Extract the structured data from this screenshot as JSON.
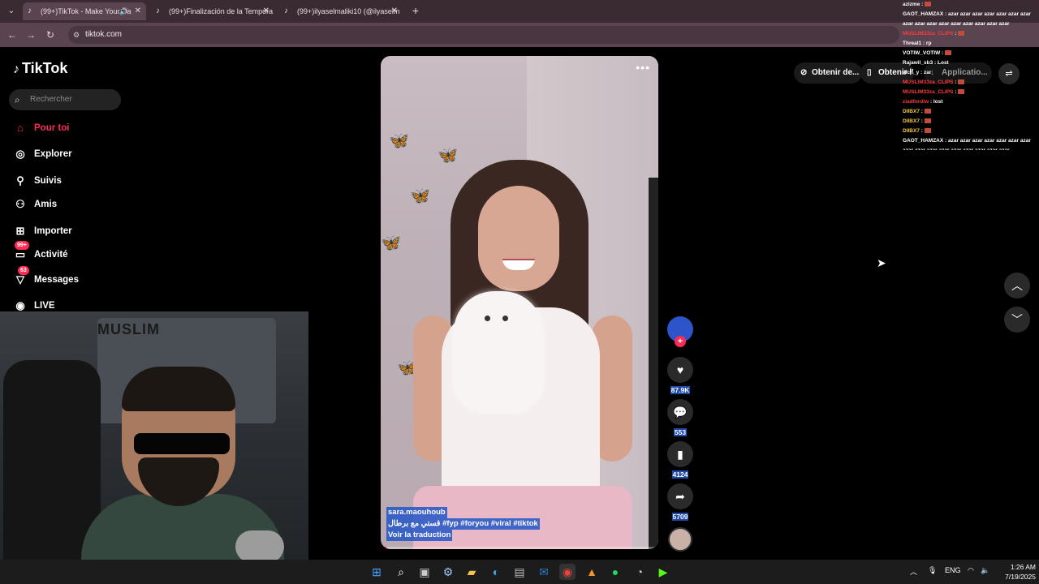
{
  "browser": {
    "tabs": [
      {
        "title": "(99+)TikTok - Make Your Da"
      },
      {
        "title": "(99+)Finalización de la Tempora"
      },
      {
        "title": "(99+)ilyaselmaliki10 (@ilyaselm"
      }
    ],
    "url": "tiktok.com"
  },
  "sidebar": {
    "logo": "TikTok",
    "search_placeholder": "Rechercher",
    "items": [
      {
        "label": "Pour toi",
        "icon": "home-icon"
      },
      {
        "label": "Explorer",
        "icon": "compass-icon"
      },
      {
        "label": "Suivis",
        "icon": "following-icon"
      },
      {
        "label": "Amis",
        "icon": "friends-icon"
      },
      {
        "label": "Importer",
        "icon": "upload-icon"
      },
      {
        "label": "Activité",
        "icon": "activity-icon",
        "badge": "99+"
      },
      {
        "label": "Messages",
        "icon": "messages-icon",
        "badge": "63"
      },
      {
        "label": "LIVE",
        "icon": "live-icon"
      }
    ]
  },
  "webcam": {
    "overlay_text": "MUSLIM"
  },
  "video": {
    "author": "sara.maouhoub",
    "caption": "قستي مع برطال #fyp  #foryou  #viral  #tiktok",
    "translate": "Voir la traduction",
    "progress": 0.02
  },
  "actions": {
    "likes": "87.9K",
    "comments": "553",
    "saves": "4124",
    "shares": "5709"
  },
  "top_chips": {
    "get_coins": "Obtenir de...",
    "get_app": "Obtenir l'a...",
    "application": "Applicatio..."
  },
  "chat": [
    {
      "user": "azizme",
      "msg": ":",
      "color": "#ffffff"
    },
    {
      "user": "GAOT_HAMZAX",
      "msg": ": azar azar azar azar azar azar azar azar azar azar azar azar azar azar azar azar",
      "color": "#ffffff"
    },
    {
      "user": "MUSLIM33za_CLIPS",
      "msg": ":",
      "color": "#ff3b3b"
    },
    {
      "user": "Threal1",
      "msg": ": rp",
      "color": "#ffffff"
    },
    {
      "user": "VOTIW_VOTIW",
      "msg": ":",
      "color": "#ffffff"
    },
    {
      "user": "Rajawil_sb3",
      "msg": ": Lost",
      "color": "#ffffff"
    },
    {
      "user": "aich_y",
      "msg": ": zar",
      "color": "#ffffff"
    },
    {
      "user": "MUSLIM33za_CLIPS",
      "msg": ":",
      "color": "#ff3b3b"
    },
    {
      "user": "MUSLIM33za_CLIPS",
      "msg": ":",
      "color": "#ff3b3b"
    },
    {
      "user": "ziadfordiw",
      "msg": ": lost",
      "color": "#ff3b3b"
    },
    {
      "user": "DIIBX7",
      "msg": ":",
      "color": "#f5c542"
    },
    {
      "user": "DIIBX7",
      "msg": ":",
      "color": "#f5c542"
    },
    {
      "user": "DIIBX7",
      "msg": ":",
      "color": "#f5c542"
    },
    {
      "user": "GAOT_HAMZAX",
      "msg": ": azar azar azar azar azar azar azar azar azar azar azar azar azar azar azar azar",
      "color": "#ffffff"
    }
  ],
  "taskbar": {
    "lang": "ENG",
    "time": "1:26 AM",
    "date": "7/19/2025"
  },
  "colors": {
    "accent": "#fe2c55",
    "caption_highlight": "#2355c8"
  }
}
